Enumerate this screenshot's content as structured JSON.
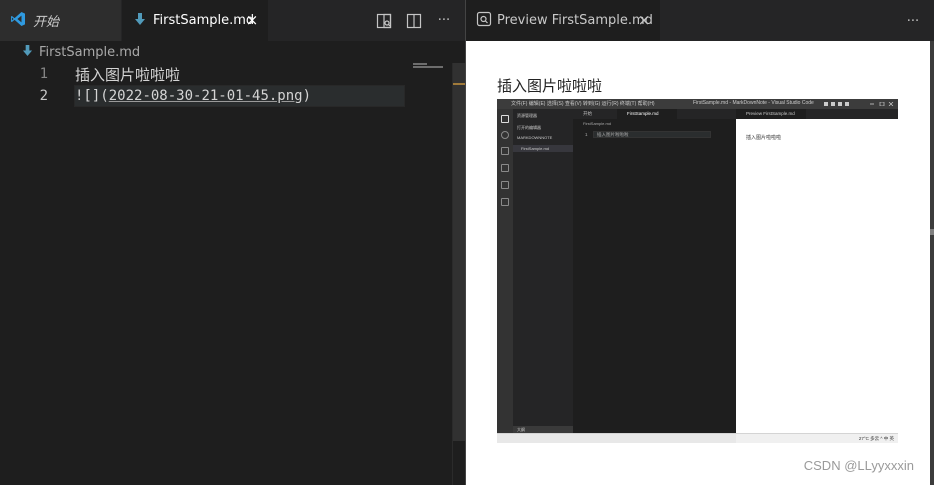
{
  "left_group": {
    "tabs": [
      {
        "label": "开始",
        "icon": "vscode-logo-icon",
        "italic": true,
        "active": false
      },
      {
        "label": "FirstSample.md",
        "icon": "markdown-down-arrow-icon",
        "active": true,
        "close": "×"
      }
    ],
    "actions": {
      "open_preview": "open-preview-icon",
      "split_editor": "split-editor-icon",
      "more": "···"
    },
    "breadcrumb": {
      "file": "FirstSample.md"
    },
    "lines": [
      {
        "number": "1",
        "text": "插入图片啦啦啦"
      },
      {
        "number": "2",
        "bang": "![]",
        "open": "(",
        "url": "2022-08-30-21-01-45.png",
        "close": ")"
      }
    ]
  },
  "right_group": {
    "tab": {
      "label": "Preview FirstSample.md",
      "icon": "preview-icon",
      "close": "×"
    },
    "more": "···",
    "preview": {
      "heading": "插入图片啦啦啦",
      "image": {
        "title_text": "文件(F)  编辑(E)  选择(S)  查看(V)  转到(G)  运行(R)  终端(T)  帮助(H)",
        "window_title": "FirstSample.md - MarkDownNote - Visual Studio Code",
        "sidebar": {
          "header": "资源管理器",
          "section_open": "打开的编辑器",
          "project": "MARKDOWNNOTE",
          "file": "FirstSample.md",
          "bottom": "大纲"
        },
        "editor_tabs": [
          "开始",
          "FirstSample.md"
        ],
        "editor_breadcrumb": "FirstSample.md",
        "editor_line_num": "1",
        "editor_line": "插入图片啦啦啦",
        "preview_tab": "Preview FirstSample.md",
        "preview_text": "插入图片啦啦啦",
        "taskbar": "27°C  多云  ^  中  英"
      }
    },
    "watermark": "CSDN @LLyyxxxin"
  },
  "colors": {
    "editor_bg": "#1e1e1e",
    "tabbar_bg": "#252526",
    "inactive_tab_bg": "#2d2d2d",
    "markdown_icon": "#519aba",
    "vscode_blue": "#2f9ae0",
    "preview_bg": "#ffffff"
  }
}
